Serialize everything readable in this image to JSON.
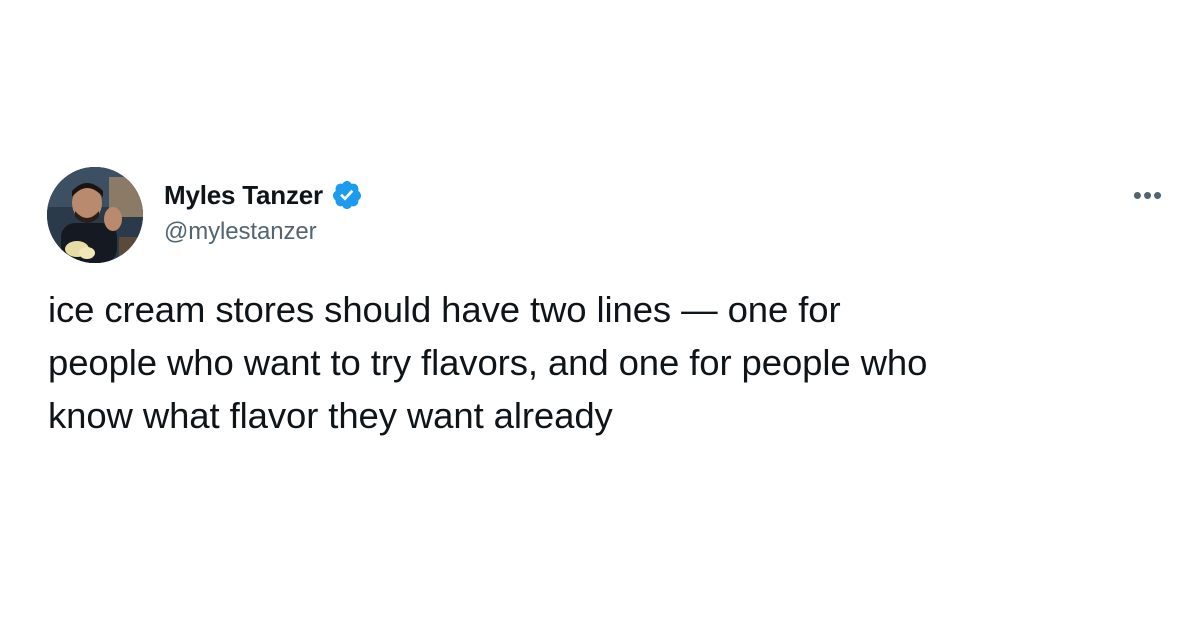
{
  "author": {
    "display_name": "Myles Tanzer",
    "handle": "@mylestanzer",
    "verified": true,
    "verified_icon": "verified-badge-icon",
    "avatar_icon": "profile-photo"
  },
  "menu": {
    "more_label": "•••",
    "icon": "more-options-icon"
  },
  "tweet": {
    "lines": [
      "ice cream stores should have two lines — one for",
      "people who want to try flavors, and one for people who",
      "know what flavor they want already"
    ]
  },
  "colors": {
    "text": "#0f1419",
    "secondary": "#536471",
    "verified": "#1d9bf0",
    "background": "#ffffff"
  }
}
